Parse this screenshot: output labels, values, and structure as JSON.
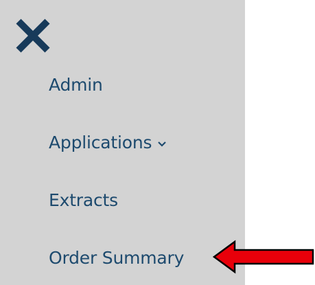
{
  "menu": {
    "close_icon": "close-icon",
    "items": [
      {
        "label": "Admin"
      },
      {
        "label": "Applications",
        "icon": "chevron-down-icon"
      },
      {
        "label": "Extracts"
      },
      {
        "label": "Order Summary"
      }
    ]
  },
  "annotation": {
    "arrow_icon": "red-arrow-left-icon",
    "arrow_color": "#e8000a",
    "arrow_outline": "#000000"
  },
  "colors": {
    "panel_background": "#d3d3d3",
    "text": "#1d4a6e",
    "page_background": "#ffffff"
  }
}
